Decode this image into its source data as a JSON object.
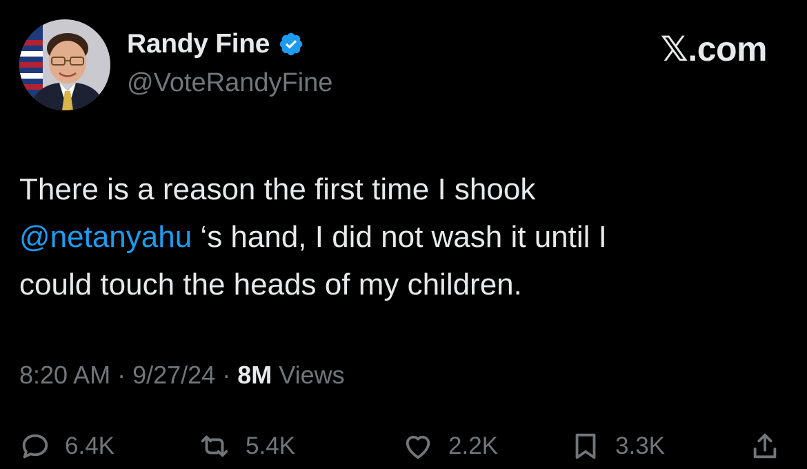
{
  "author": {
    "display_name": "Randy Fine",
    "handle": "@VoteRandyFine",
    "verified": true,
    "verified_color": "#1d9bf0"
  },
  "site_logo": "𝕏.com",
  "tweet": {
    "line1": "There is a reason the first time I shook",
    "mention": "@netanyahu",
    "line2_rest": " ‘s hand, I did not wash it until I",
    "line3": "could touch the heads of my children."
  },
  "meta": {
    "time": "8:20 AM",
    "separator": " · ",
    "date": "9/27/24",
    "views_count": "8M",
    "views_label": " Views"
  },
  "actions": [
    {
      "icon": "reply-icon",
      "count": "6.4K"
    },
    {
      "icon": "retweet-icon",
      "count": "5.4K"
    },
    {
      "icon": "like-icon",
      "count": "2.2K"
    },
    {
      "icon": "bookmark-icon",
      "count": "3.3K"
    },
    {
      "icon": "share-icon"
    }
  ],
  "colors": {
    "background": "#000000",
    "text": "#e7e9ea",
    "secondary": "#71767b",
    "link": "#1d9bf0"
  }
}
